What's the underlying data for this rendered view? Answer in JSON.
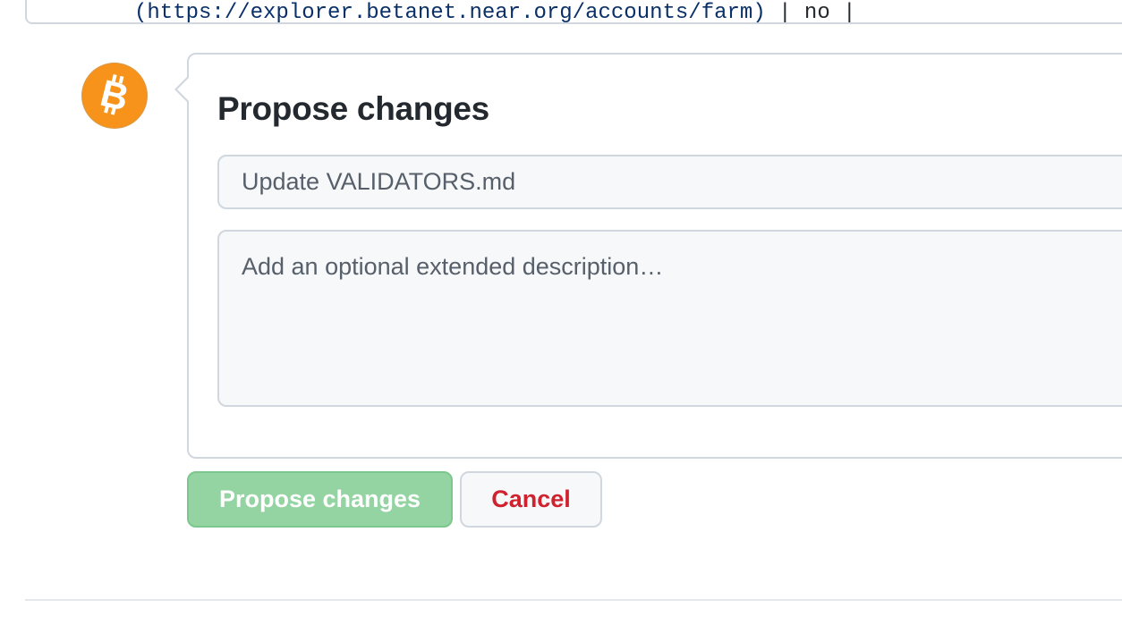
{
  "editor": {
    "link_text": "(https://explorer.betanet.near.org/accounts/farm)",
    "trailing_text": " | no |"
  },
  "avatar": {
    "icon": "bitcoin-icon",
    "color": "#f7931a"
  },
  "form": {
    "title": "Propose changes",
    "summary_placeholder": "Update VALIDATORS.md",
    "description_placeholder": "Add an optional extended description…"
  },
  "buttons": {
    "propose_label": "Propose changes",
    "cancel_label": "Cancel"
  },
  "colors": {
    "propose_button_bg": "#94d3a2",
    "cancel_text": "#cf222e",
    "border": "#d0d7de"
  }
}
